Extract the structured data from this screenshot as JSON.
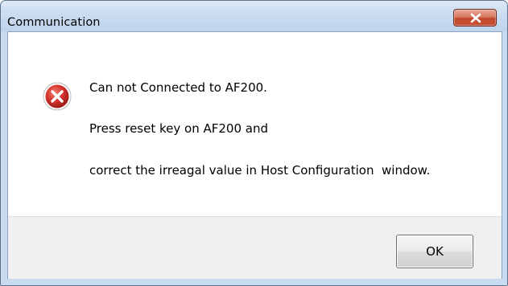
{
  "window": {
    "title": "Communication"
  },
  "titlebar": {
    "close_icon": "close-icon"
  },
  "message": {
    "icon": "error-icon",
    "line1": "Can not Connected to AF200.",
    "line2": "Press reset key on AF200 and",
    "line3": "correct the irreagal value in Host Configuration  window."
  },
  "buttons": {
    "ok_label": "OK"
  },
  "colors": {
    "error_red": "#d4332c",
    "close_button_red": "#c7472b",
    "title_bar": "#c9dbef"
  }
}
